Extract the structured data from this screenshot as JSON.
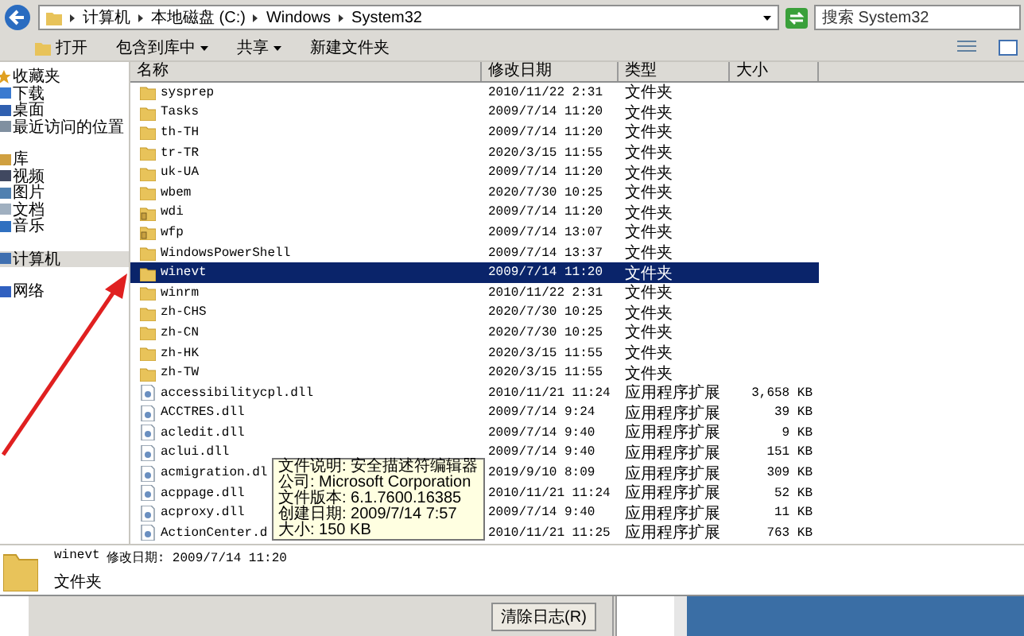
{
  "address": {
    "segments": [
      "计算机",
      "本地磁盘 (C:)",
      "Windows",
      "System32"
    ]
  },
  "search": {
    "placeholder": "搜索 System32"
  },
  "toolbar": {
    "items": [
      {
        "label": "打开",
        "dropdown": false,
        "kind": "open"
      },
      {
        "label": "包含到库中",
        "dropdown": true,
        "kind": "plain"
      },
      {
        "label": "共享",
        "dropdown": true,
        "kind": "plain"
      },
      {
        "label": "新建文件夹",
        "dropdown": false,
        "kind": "plain"
      }
    ]
  },
  "nav": {
    "items": [
      {
        "label": "收藏夹",
        "selected": false,
        "kind": "star",
        "children": [
          {
            "label": "下载",
            "selected": false,
            "kind": "download"
          },
          {
            "label": "桌面",
            "selected": false,
            "kind": "desktop"
          },
          {
            "label": "最近访问的位置",
            "selected": false,
            "kind": "recent"
          }
        ]
      },
      {
        "label": "库",
        "selected": false,
        "kind": "library",
        "children": [
          {
            "label": "视频",
            "selected": false,
            "kind": "video"
          },
          {
            "label": "图片",
            "selected": false,
            "kind": "picture"
          },
          {
            "label": "文档",
            "selected": false,
            "kind": "document"
          },
          {
            "label": "音乐",
            "selected": false,
            "kind": "music"
          }
        ]
      },
      {
        "label": "计算机",
        "selected": true,
        "kind": "computer"
      },
      {
        "label": "网络",
        "selected": false,
        "kind": "network"
      }
    ]
  },
  "table": {
    "columns": [
      "名称",
      "修改日期",
      "类型",
      "大小"
    ],
    "rows": [
      {
        "name": "sysprep",
        "kind": "folder",
        "date": "2010/11/22 2:31",
        "type": "文件夹",
        "selected": false
      },
      {
        "name": "Tasks",
        "kind": "folder",
        "date": "2009/7/14 11:20",
        "type": "文件夹",
        "selected": false
      },
      {
        "name": "th-TH",
        "kind": "folder",
        "date": "2009/7/14 11:20",
        "type": "文件夹",
        "selected": false
      },
      {
        "name": "tr-TR",
        "kind": "folder",
        "date": "2020/3/15 11:55",
        "type": "文件夹",
        "selected": false
      },
      {
        "name": "uk-UA",
        "kind": "folder",
        "date": "2009/7/14 11:20",
        "type": "文件夹",
        "selected": false
      },
      {
        "name": "wbem",
        "kind": "folder",
        "date": "2020/7/30 10:25",
        "type": "文件夹",
        "selected": false
      },
      {
        "name": "wdi",
        "kind": "locked_folder",
        "date": "2009/7/14 11:20",
        "type": "文件夹",
        "selected": false
      },
      {
        "name": "wfp",
        "kind": "locked_folder",
        "date": "2009/7/14 13:07",
        "type": "文件夹",
        "selected": false
      },
      {
        "name": "WindowsPowerShell",
        "kind": "folder",
        "date": "2009/7/14 13:37",
        "type": "文件夹",
        "selected": false
      },
      {
        "name": "winevt",
        "kind": "folder",
        "date": "2009/7/14 11:20",
        "type": "文件夹",
        "selected": true
      },
      {
        "name": "winrm",
        "kind": "folder",
        "date": "2010/11/22 2:31",
        "type": "文件夹",
        "selected": false
      },
      {
        "name": "zh-CHS",
        "kind": "folder",
        "date": "2020/7/30 10:25",
        "type": "文件夹",
        "selected": false
      },
      {
        "name": "zh-CN",
        "kind": "folder",
        "date": "2020/7/30 10:25",
        "type": "文件夹",
        "selected": false
      },
      {
        "name": "zh-HK",
        "kind": "folder",
        "date": "2020/3/15 11:55",
        "type": "文件夹",
        "selected": false
      },
      {
        "name": "zh-TW",
        "kind": "folder",
        "date": "2020/3/15 11:55",
        "type": "文件夹",
        "selected": false
      },
      {
        "name": "accessibilitycpl.dll",
        "kind": "dll",
        "date": "2010/11/21 11:24",
        "type": "应用程序扩展",
        "size": "3,658 KB",
        "selected": false
      },
      {
        "name": "ACCTRES.dll",
        "kind": "dll",
        "date": "2009/7/14 9:24",
        "type": "应用程序扩展",
        "size": "39 KB",
        "selected": false
      },
      {
        "name": "acledit.dll",
        "kind": "dll",
        "date": "2009/7/14 9:40",
        "type": "应用程序扩展",
        "size": "9 KB",
        "selected": false
      },
      {
        "name": "aclui.dll",
        "kind": "dll",
        "date": "2009/7/14 9:40",
        "type": "应用程序扩展",
        "size": "151 KB",
        "selected": false
      },
      {
        "name": "acmigration.dl",
        "kind": "dll",
        "date": "2019/9/10 8:09",
        "type": "应用程序扩展",
        "size": "309 KB",
        "selected": false
      },
      {
        "name": "acppage.dll",
        "kind": "dll",
        "date": "2010/11/21 11:24",
        "type": "应用程序扩展",
        "size": "52 KB",
        "selected": false
      },
      {
        "name": "acproxy.dll",
        "kind": "dll",
        "date": "2009/7/14 9:40",
        "type": "应用程序扩展",
        "size": "11 KB",
        "selected": false
      },
      {
        "name": "ActionCenter.d",
        "kind": "dll",
        "date": "2010/11/21 11:25",
        "type": "应用程序扩展",
        "size": "763 KB",
        "selected": false
      }
    ]
  },
  "tooltip": {
    "lines": [
      "文件说明: 安全描述符编辑器",
      "公司: Microsoft Corporation",
      "文件版本: 6.1.7600.16385",
      "创建日期: 2009/7/14 7:57",
      "大小: 150 KB"
    ]
  },
  "details": {
    "name": "winevt",
    "meta": "修改日期: 2009/7/14 11:20",
    "type": "文件夹"
  },
  "footer": {
    "button": "清除日志(R)"
  }
}
